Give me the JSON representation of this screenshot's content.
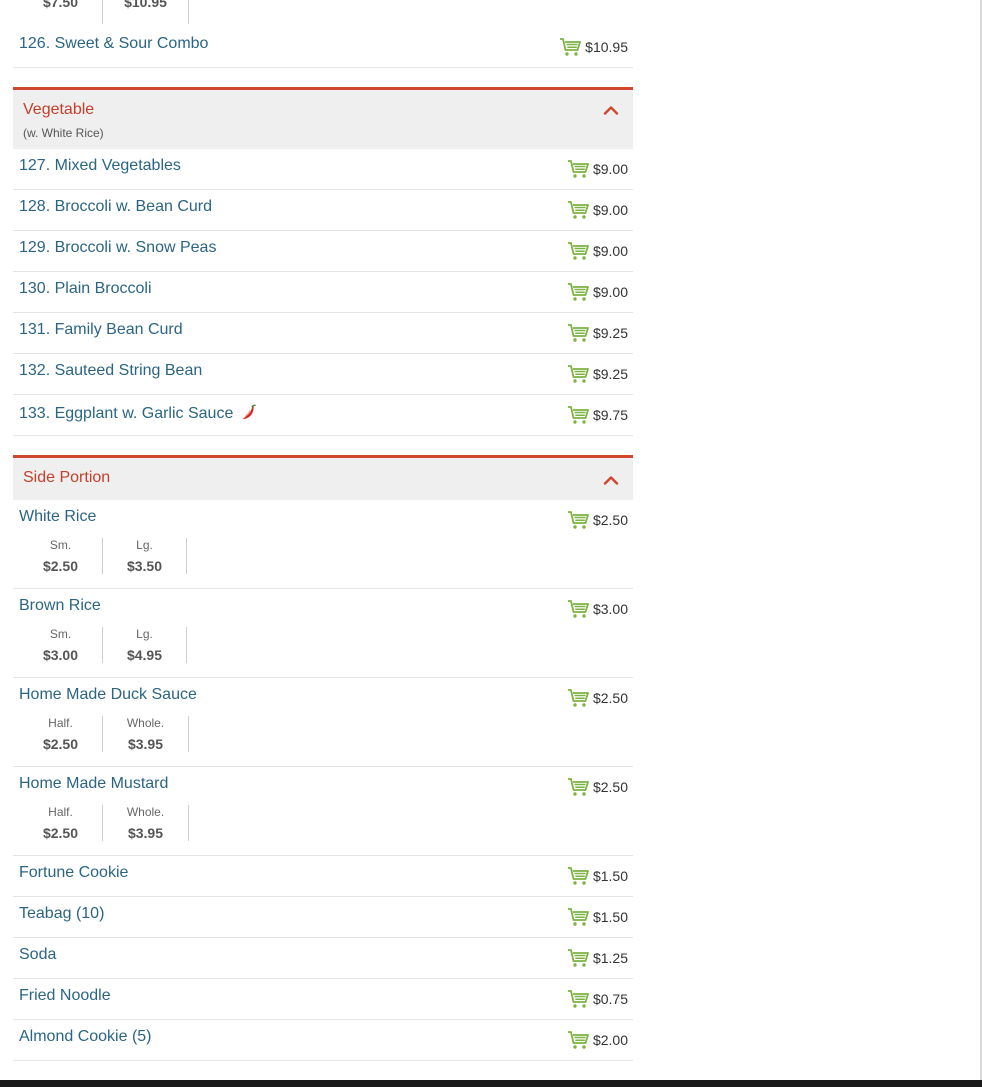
{
  "top_partial": {
    "sizes": [
      {
        "label": "",
        "price": "$7.50"
      },
      {
        "label": "",
        "price": "$10.95"
      }
    ]
  },
  "combo_item": {
    "name": "126. Sweet & Sour Combo",
    "price": "$10.95"
  },
  "vegetable": {
    "title": "Vegetable",
    "subtitle": "(w. White Rice)",
    "items": [
      {
        "name": "127. Mixed Vegetables",
        "price": "$9.00"
      },
      {
        "name": "128. Broccoli w. Bean Curd",
        "price": "$9.00"
      },
      {
        "name": "129. Broccoli w. Snow Peas",
        "price": "$9.00"
      },
      {
        "name": "130. Plain Broccoli",
        "price": "$9.00"
      },
      {
        "name": "131. Family Bean Curd",
        "price": "$9.25"
      },
      {
        "name": "132. Sauteed String Bean",
        "price": "$9.25"
      },
      {
        "name": "133. Eggplant w. Garlic Sauce",
        "price": "$9.75",
        "spicy_icon": "chili-pepper-icon"
      }
    ]
  },
  "side_portion": {
    "title": "Side Portion",
    "sized_items": [
      {
        "name": "White Rice",
        "price": "$2.50",
        "sizes": [
          {
            "label": "Sm.",
            "price": "$2.50"
          },
          {
            "label": "Lg.",
            "price": "$3.50"
          }
        ]
      },
      {
        "name": "Brown Rice",
        "price": "$3.00",
        "sizes": [
          {
            "label": "Sm.",
            "price": "$3.00"
          },
          {
            "label": "Lg.",
            "price": "$4.95"
          }
        ]
      },
      {
        "name": "Home Made Duck Sauce",
        "price": "$2.50",
        "sizes": [
          {
            "label": "Half.",
            "price": "$2.50"
          },
          {
            "label": "Whole.",
            "price": "$3.95"
          }
        ]
      },
      {
        "name": "Home Made Mustard",
        "price": "$2.50",
        "sizes": [
          {
            "label": "Half.",
            "price": "$2.50"
          },
          {
            "label": "Whole.",
            "price": "$3.95"
          }
        ]
      }
    ],
    "simple_items": [
      {
        "name": "Fortune Cookie",
        "price": "$1.50"
      },
      {
        "name": "Teabag (10)",
        "price": "$1.50"
      },
      {
        "name": "Soda",
        "price": "$1.25"
      },
      {
        "name": "Fried Noodle",
        "price": "$0.75"
      },
      {
        "name": "Almond Cookie (5)",
        "price": "$2.00"
      }
    ]
  },
  "icons": {
    "cart": "shopping-cart-icon",
    "chevron": "chevron-up-icon"
  },
  "colors": {
    "accent": "#d1472e",
    "link": "#2b6583",
    "cart_green": "#7cb342",
    "section_bg": "#efefef"
  }
}
